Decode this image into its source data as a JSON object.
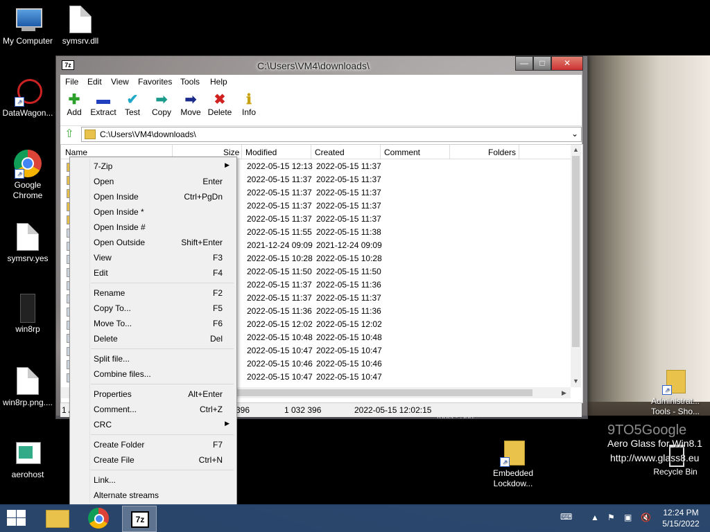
{
  "desktop": {
    "icons": [
      {
        "label": "My Computer"
      },
      {
        "label": "symsrv.dll"
      },
      {
        "label": "DataWagon..."
      },
      {
        "label": "Google Chrome"
      },
      {
        "label": "symsrv.yes"
      },
      {
        "label": "win8rp"
      },
      {
        "label": "win8rp.png...."
      },
      {
        "label": "aerohost"
      },
      {
        "label": "Administrat... Tools - Sho..."
      },
      {
        "label": "Embedded Lockdow..."
      },
      {
        "label": "Recycle Bin"
      }
    ],
    "watermark_brand": "9TO5Google",
    "watermark_line1": "Aero Glass for Win8.1",
    "watermark_line2": "http://www.glass8.eu",
    "behind_label": "Tools - Sho..."
  },
  "window": {
    "title": "C:\\Users\\VM4\\downloads\\",
    "app_icon": "7z",
    "buttons": {
      "minimize": "—",
      "maximize": "□",
      "close": "✕"
    },
    "menu": [
      "File",
      "Edit",
      "View",
      "Favorites",
      "Tools",
      "Help"
    ],
    "toolbar": [
      {
        "label": "Add",
        "icon": "plus-icon",
        "glyph": "✚",
        "color": "#2aa02a"
      },
      {
        "label": "Extract",
        "icon": "minus-icon",
        "glyph": "▬",
        "color": "#1f3fbf"
      },
      {
        "label": "Test",
        "icon": "check-icon",
        "glyph": "✔",
        "color": "#20a8c8"
      },
      {
        "label": "Copy",
        "icon": "arrow-right-icon",
        "glyph": "➡",
        "color": "#1a9a8a"
      },
      {
        "label": "Move",
        "icon": "arrow-right-icon",
        "glyph": "➡",
        "color": "#1a2a8a"
      },
      {
        "label": "Delete",
        "icon": "x-icon",
        "glyph": "✖",
        "color": "#d02020"
      },
      {
        "label": "Info",
        "icon": "info-icon",
        "glyph": "ℹ",
        "color": "#c8a010"
      }
    ],
    "address": "C:\\Users\\VM4\\downloads\\",
    "columns": {
      "name": "Name",
      "size": "Size",
      "modified": "Modified",
      "created": "Created",
      "comment": "Comment",
      "folders": "Folders"
    },
    "rows": [
      {
        "modified": "2022-05-15 12:13",
        "created": "2022-05-15 11:37"
      },
      {
        "modified": "2022-05-15 11:37",
        "created": "2022-05-15 11:37"
      },
      {
        "modified": "2022-05-15 11:37",
        "created": "2022-05-15 11:37"
      },
      {
        "modified": "2022-05-15 11:37",
        "created": "2022-05-15 11:37"
      },
      {
        "modified": "2022-05-15 11:37",
        "created": "2022-05-15 11:37"
      },
      {
        "modified": "2022-05-15 11:55",
        "created": "2022-05-15 11:38"
      },
      {
        "modified": "2021-12-24 09:09",
        "created": "2021-12-24 09:09"
      },
      {
        "modified": "2022-05-15 10:28",
        "created": "2022-05-15 10:28"
      },
      {
        "modified": "2022-05-15 11:50",
        "created": "2022-05-15 11:50"
      },
      {
        "modified": "2022-05-15 11:37",
        "created": "2022-05-15 11:36"
      },
      {
        "modified": "2022-05-15 11:37",
        "created": "2022-05-15 11:37"
      },
      {
        "modified": "2022-05-15 11:36",
        "created": "2022-05-15 11:36"
      },
      {
        "modified": "2022-05-15 12:02",
        "created": "2022-05-15 12:02"
      },
      {
        "modified": "2022-05-15 10:48",
        "created": "2022-05-15 10:48"
      },
      {
        "modified": "2022-05-15 10:47",
        "created": "2022-05-15 10:47"
      },
      {
        "modified": "2022-05-15 10:46",
        "created": "2022-05-15 10:46"
      },
      {
        "modified": "2022-05-15 10:47",
        "created": "2022-05-15 10:47"
      }
    ],
    "status": {
      "left": "1 /",
      "size1": "396",
      "size2": "1 032 396",
      "date": "2022-05-15 12:02:15"
    }
  },
  "context_menu": {
    "items": [
      {
        "label": "7-Zip",
        "shortcut": "",
        "submenu": true
      },
      {
        "label": "Open",
        "shortcut": "Enter"
      },
      {
        "label": "Open Inside",
        "shortcut": "Ctrl+PgDn"
      },
      {
        "label": "Open Inside *",
        "shortcut": ""
      },
      {
        "label": "Open Inside #",
        "shortcut": ""
      },
      {
        "label": "Open Outside",
        "shortcut": "Shift+Enter"
      },
      {
        "label": "View",
        "shortcut": "F3"
      },
      {
        "label": "Edit",
        "shortcut": "F4"
      },
      {
        "label": "Rename",
        "shortcut": "F2"
      },
      {
        "label": "Copy To...",
        "shortcut": "F5"
      },
      {
        "label": "Move To...",
        "shortcut": "F6"
      },
      {
        "label": "Delete",
        "shortcut": "Del"
      },
      {
        "label": "Split file...",
        "shortcut": ""
      },
      {
        "label": "Combine files...",
        "shortcut": ""
      },
      {
        "label": "Properties",
        "shortcut": "Alt+Enter"
      },
      {
        "label": "Comment...",
        "shortcut": "Ctrl+Z"
      },
      {
        "label": "CRC",
        "shortcut": "",
        "submenu": true
      },
      {
        "label": "Create Folder",
        "shortcut": "F7"
      },
      {
        "label": "Create File",
        "shortcut": "Ctrl+N"
      },
      {
        "label": "Link...",
        "shortcut": ""
      },
      {
        "label": "Alternate streams",
        "shortcut": ""
      }
    ]
  },
  "taskbar": {
    "clock_time": "12:24 PM",
    "clock_date": "5/15/2022",
    "tasks": [
      "File Explorer",
      "Google Chrome",
      "7-Zip"
    ]
  }
}
